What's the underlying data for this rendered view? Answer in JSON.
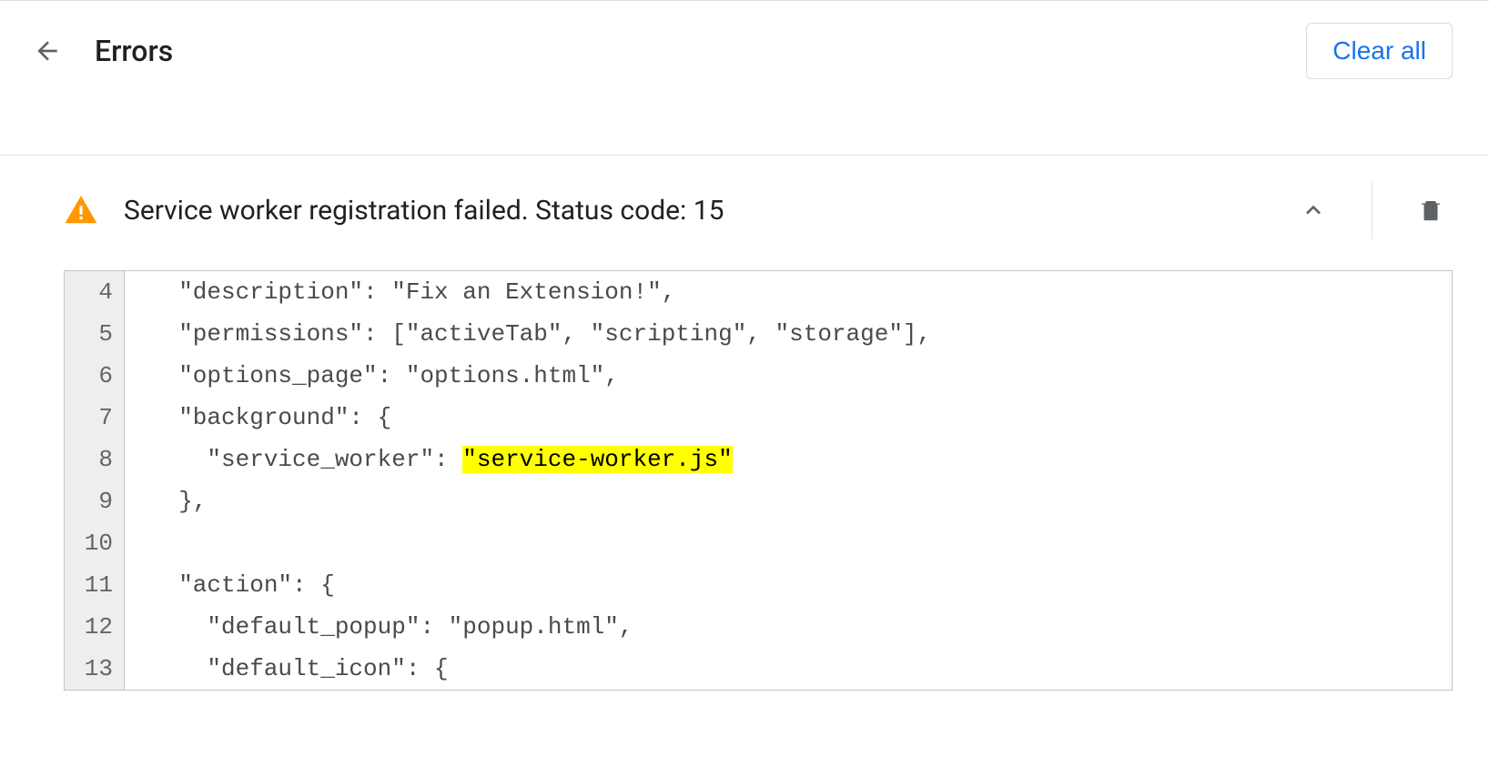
{
  "header": {
    "title": "Errors",
    "clear_button": "Clear all"
  },
  "error": {
    "message": "Service worker registration failed. Status code: 15",
    "highlighted_text": "\"service-worker.js\"",
    "code_lines": [
      {
        "num": 4,
        "pre": "  \"description\": \"Fix an Extension!\",",
        "hl": "",
        "post": ""
      },
      {
        "num": 5,
        "pre": "  \"permissions\": [\"activeTab\", \"scripting\", \"storage\"],",
        "hl": "",
        "post": ""
      },
      {
        "num": 6,
        "pre": "  \"options_page\": \"options.html\",",
        "hl": "",
        "post": ""
      },
      {
        "num": 7,
        "pre": "  \"background\": {",
        "hl": "",
        "post": ""
      },
      {
        "num": 8,
        "pre": "    \"service_worker\": ",
        "hl": "\"service-worker.js\"",
        "post": ""
      },
      {
        "num": 9,
        "pre": "  },",
        "hl": "",
        "post": ""
      },
      {
        "num": 10,
        "pre": "",
        "hl": "",
        "post": ""
      },
      {
        "num": 11,
        "pre": "  \"action\": {",
        "hl": "",
        "post": ""
      },
      {
        "num": 12,
        "pre": "    \"default_popup\": \"popup.html\",",
        "hl": "",
        "post": ""
      },
      {
        "num": 13,
        "pre": "    \"default_icon\": {",
        "hl": "",
        "post": ""
      }
    ]
  }
}
